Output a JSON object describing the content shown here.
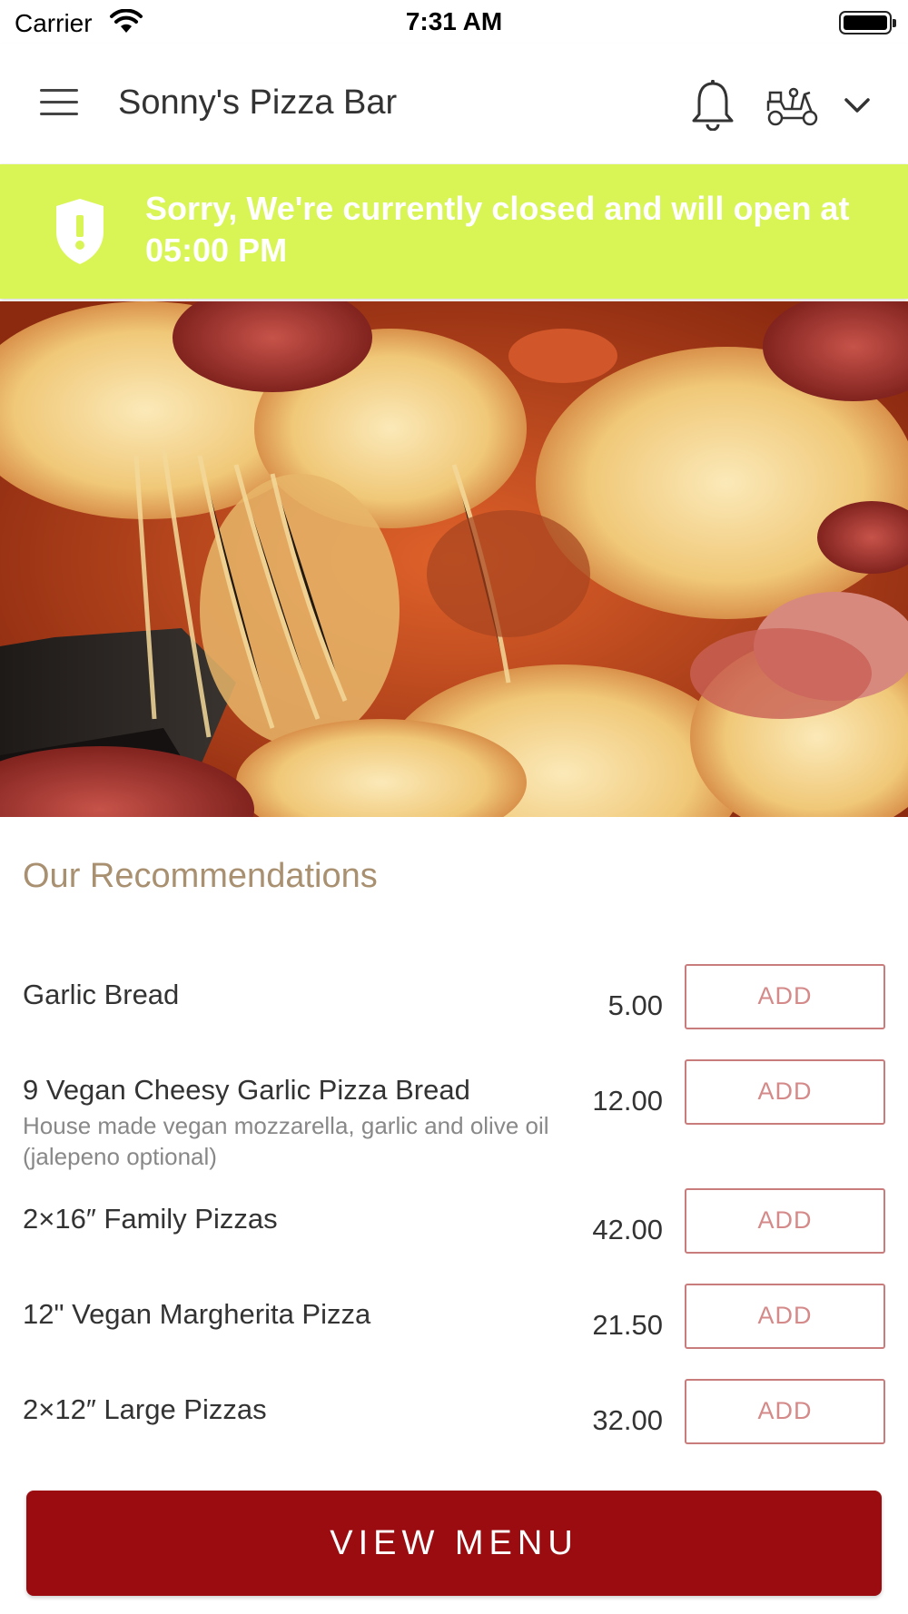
{
  "status_bar": {
    "carrier": "Carrier",
    "time": "7:31 AM"
  },
  "header": {
    "title": "Sonny's Pizza Bar"
  },
  "banner": {
    "message": "Sorry, We're currently closed and will open at 05:00 PM",
    "color": "#d9f455"
  },
  "hero": {
    "icon": "pizza-photo"
  },
  "recommendations": {
    "title": "Our Recommendations",
    "items": [
      {
        "name": "Garlic Bread",
        "description": "",
        "price": "5.00",
        "button": "ADD"
      },
      {
        "name": "9 Vegan Cheesy Garlic Pizza Bread",
        "description": "House made vegan mozzarella, garlic and olive oil (jalepeno optional)",
        "price": "12.00",
        "button": "ADD"
      },
      {
        "name": "2×16″ Family Pizzas",
        "description": "",
        "price": "42.00",
        "button": "ADD"
      },
      {
        "name": "12\" Vegan Margherita Pizza",
        "description": "",
        "price": "21.50",
        "button": "ADD"
      },
      {
        "name": "2×12″ Large Pizzas",
        "description": "",
        "price": "32.00",
        "button": "ADD"
      }
    ]
  },
  "view_menu": {
    "label": "VIEW MENU",
    "color": "#9b0c10"
  }
}
